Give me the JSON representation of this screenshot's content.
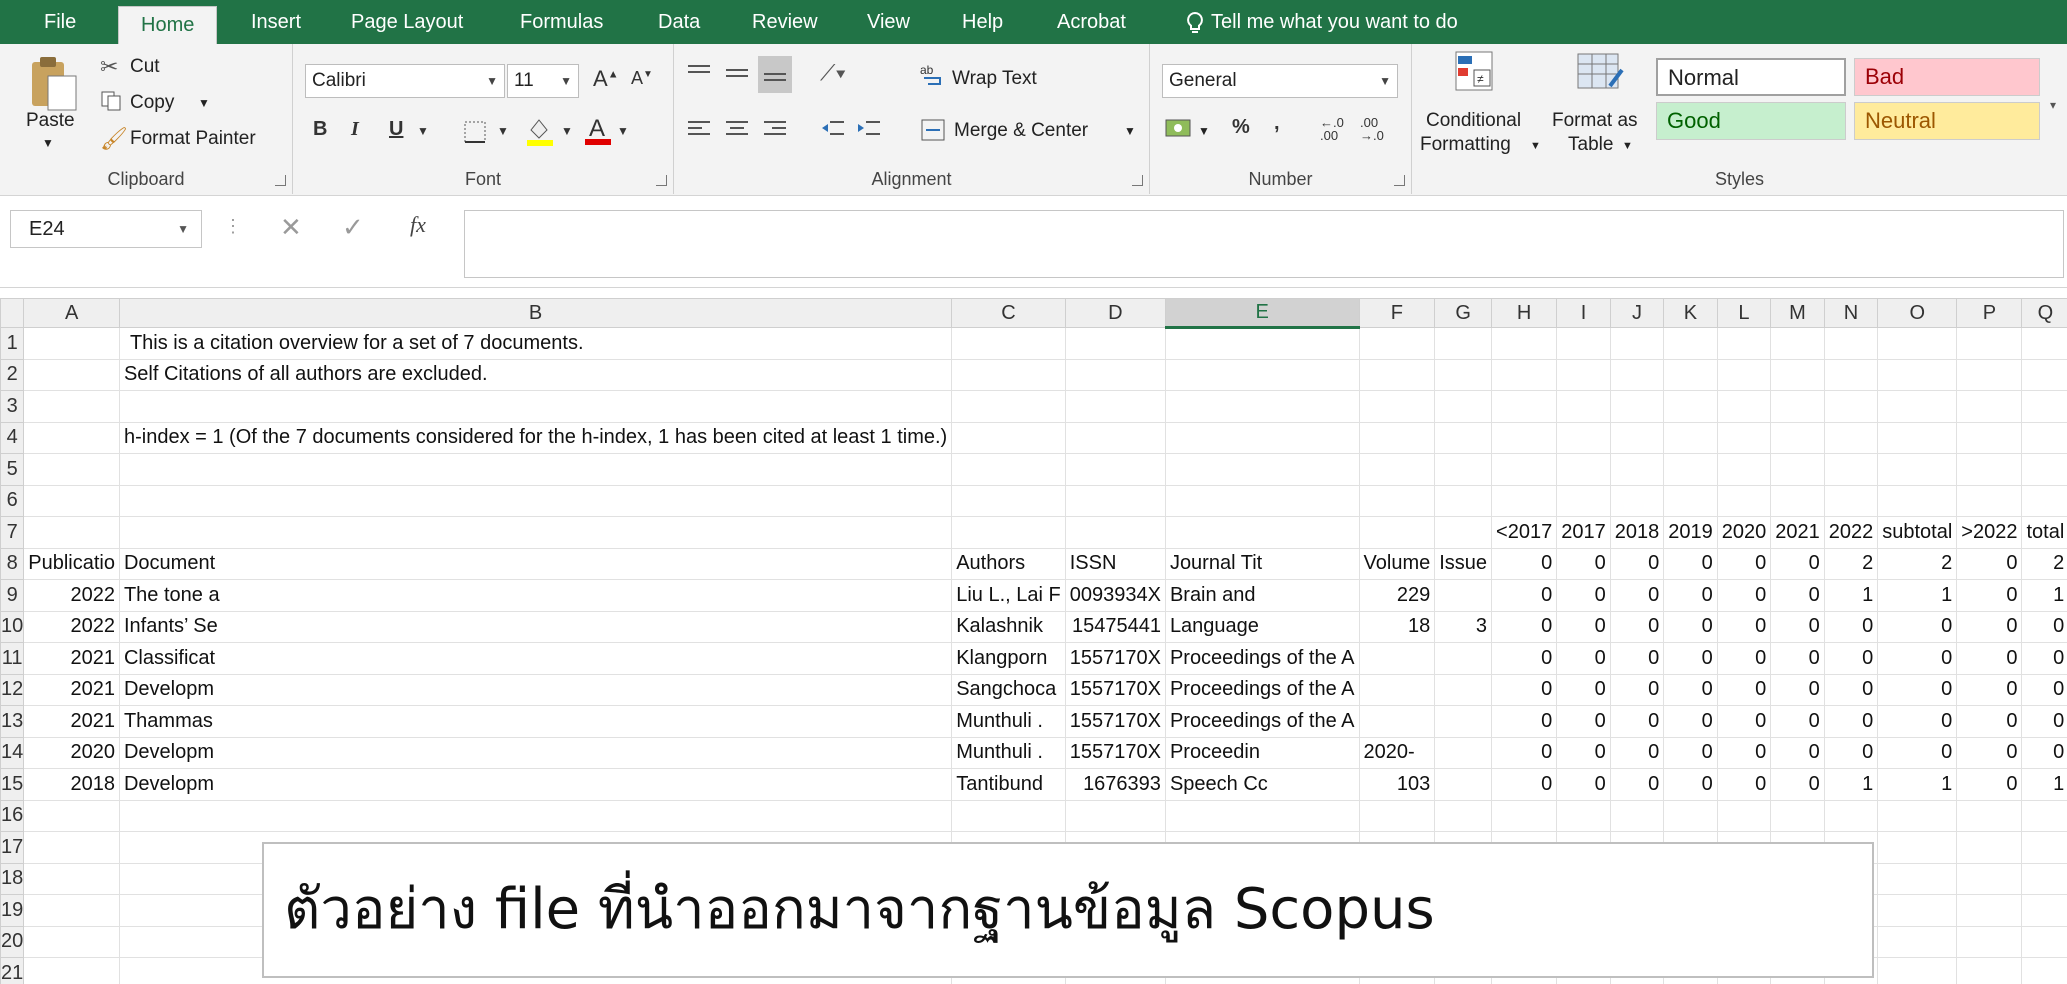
{
  "menu": {
    "tabs": [
      "File",
      "Home",
      "Insert",
      "Page Layout",
      "Formulas",
      "Data",
      "Review",
      "View",
      "Help",
      "Acrobat"
    ],
    "active": "Home",
    "tell_me": "Tell me what you want to do"
  },
  "ribbon": {
    "clipboard": {
      "paste": "Paste",
      "cut": "Cut",
      "copy": "Copy",
      "format_painter": "Format Painter",
      "label": "Clipboard"
    },
    "font": {
      "name": "Calibri",
      "size": "11",
      "bold": "B",
      "italic": "I",
      "underline": "U",
      "label": "Font"
    },
    "alignment": {
      "wrap_text": "Wrap Text",
      "merge_center": "Merge & Center",
      "label": "Alignment"
    },
    "number": {
      "format": "General",
      "percent": "%",
      "comma": ",",
      "label": "Number"
    },
    "styles_group": {
      "conditional_1": "Conditional",
      "conditional_2": "Formatting",
      "format_table_1": "Format as",
      "format_table_2": "Table",
      "normal": "Normal",
      "bad": "Bad",
      "good": "Good",
      "neutral": "Neutral",
      "label": "Styles"
    }
  },
  "formula_bar": {
    "name_box": "E24",
    "formula": ""
  },
  "sheet": {
    "columns": [
      "A",
      "B",
      "C",
      "D",
      "E",
      "F",
      "G",
      "H",
      "I",
      "J",
      "K",
      "L",
      "M",
      "N",
      "O",
      "P",
      "Q"
    ],
    "selected_column": "E",
    "row_numbers": [
      "1",
      "2",
      "3",
      "4",
      "5",
      "6",
      "7",
      "8",
      "9",
      "10",
      "11",
      "12",
      "13",
      "14",
      "15",
      "16",
      "17",
      "18",
      "19",
      "20",
      "21"
    ],
    "row1_text": "This is a citation overview for a set of 7 documents.",
    "row2_text": "Self Citations of all authors are excluded.",
    "row4_text": "h-index = 1 (Of the 7 documents considered for the h-index, 1 has been cited at least 1 time.)",
    "row7": [
      "",
      "",
      "",
      "",
      "",
      "",
      "",
      "<2017",
      "2017",
      "2018",
      "2019",
      "2020",
      "2021",
      "2022",
      "subtotal",
      ">2022",
      "total"
    ],
    "row8": [
      "Publicatio",
      "Document",
      "Authors",
      "ISSN",
      "Journal Tit",
      "Volume",
      "Issue",
      "0",
      "0",
      "0",
      "0",
      "0",
      "0",
      "2",
      "2",
      "0",
      "2"
    ],
    "data_rows": [
      [
        "2022",
        "The tone a",
        "Liu L., Lai F",
        "0093934X",
        "Brain and",
        "229",
        "",
        "0",
        "0",
        "0",
        "0",
        "0",
        "0",
        "1",
        "1",
        "0",
        "1"
      ],
      [
        "2022",
        "Infants’ Se",
        "Kalashnik",
        "15475441",
        "Language",
        "18",
        "3",
        "0",
        "0",
        "0",
        "0",
        "0",
        "0",
        "0",
        "0",
        "0",
        "0"
      ],
      [
        "2021",
        "Classificat",
        "Klangporn",
        "1557170X",
        "Proceedings of the A",
        "",
        "",
        "0",
        "0",
        "0",
        "0",
        "0",
        "0",
        "0",
        "0",
        "0",
        "0"
      ],
      [
        "2021",
        "Developm",
        "Sangchoca",
        "1557170X",
        "Proceedings of the A",
        "",
        "",
        "0",
        "0",
        "0",
        "0",
        "0",
        "0",
        "0",
        "0",
        "0",
        "0"
      ],
      [
        "2021",
        "Thammas",
        "Munthuli .",
        "1557170X",
        "Proceedings of the A",
        "",
        "",
        "0",
        "0",
        "0",
        "0",
        "0",
        "0",
        "0",
        "0",
        "0",
        "0"
      ],
      [
        "2020",
        "Developm",
        "Munthuli .",
        "1557170X",
        "Proceedin",
        "2020-",
        "",
        "0",
        "0",
        "0",
        "0",
        "0",
        "0",
        "0",
        "0",
        "0",
        "0"
      ],
      [
        "2018",
        "Developm",
        "Tantibund",
        "1676393",
        "Speech Cc",
        "103",
        "",
        "0",
        "0",
        "0",
        "0",
        "0",
        "0",
        "1",
        "1",
        "0",
        "1"
      ]
    ]
  },
  "caption": "ตัวอย่าง file ที่นำออกมาจากฐานข้อมูล Scopus",
  "colors": {
    "excel_green": "#217346",
    "bad_bg": "#ffc7ce",
    "good_bg": "#c6efce",
    "neutral_bg": "#ffeb9c"
  }
}
